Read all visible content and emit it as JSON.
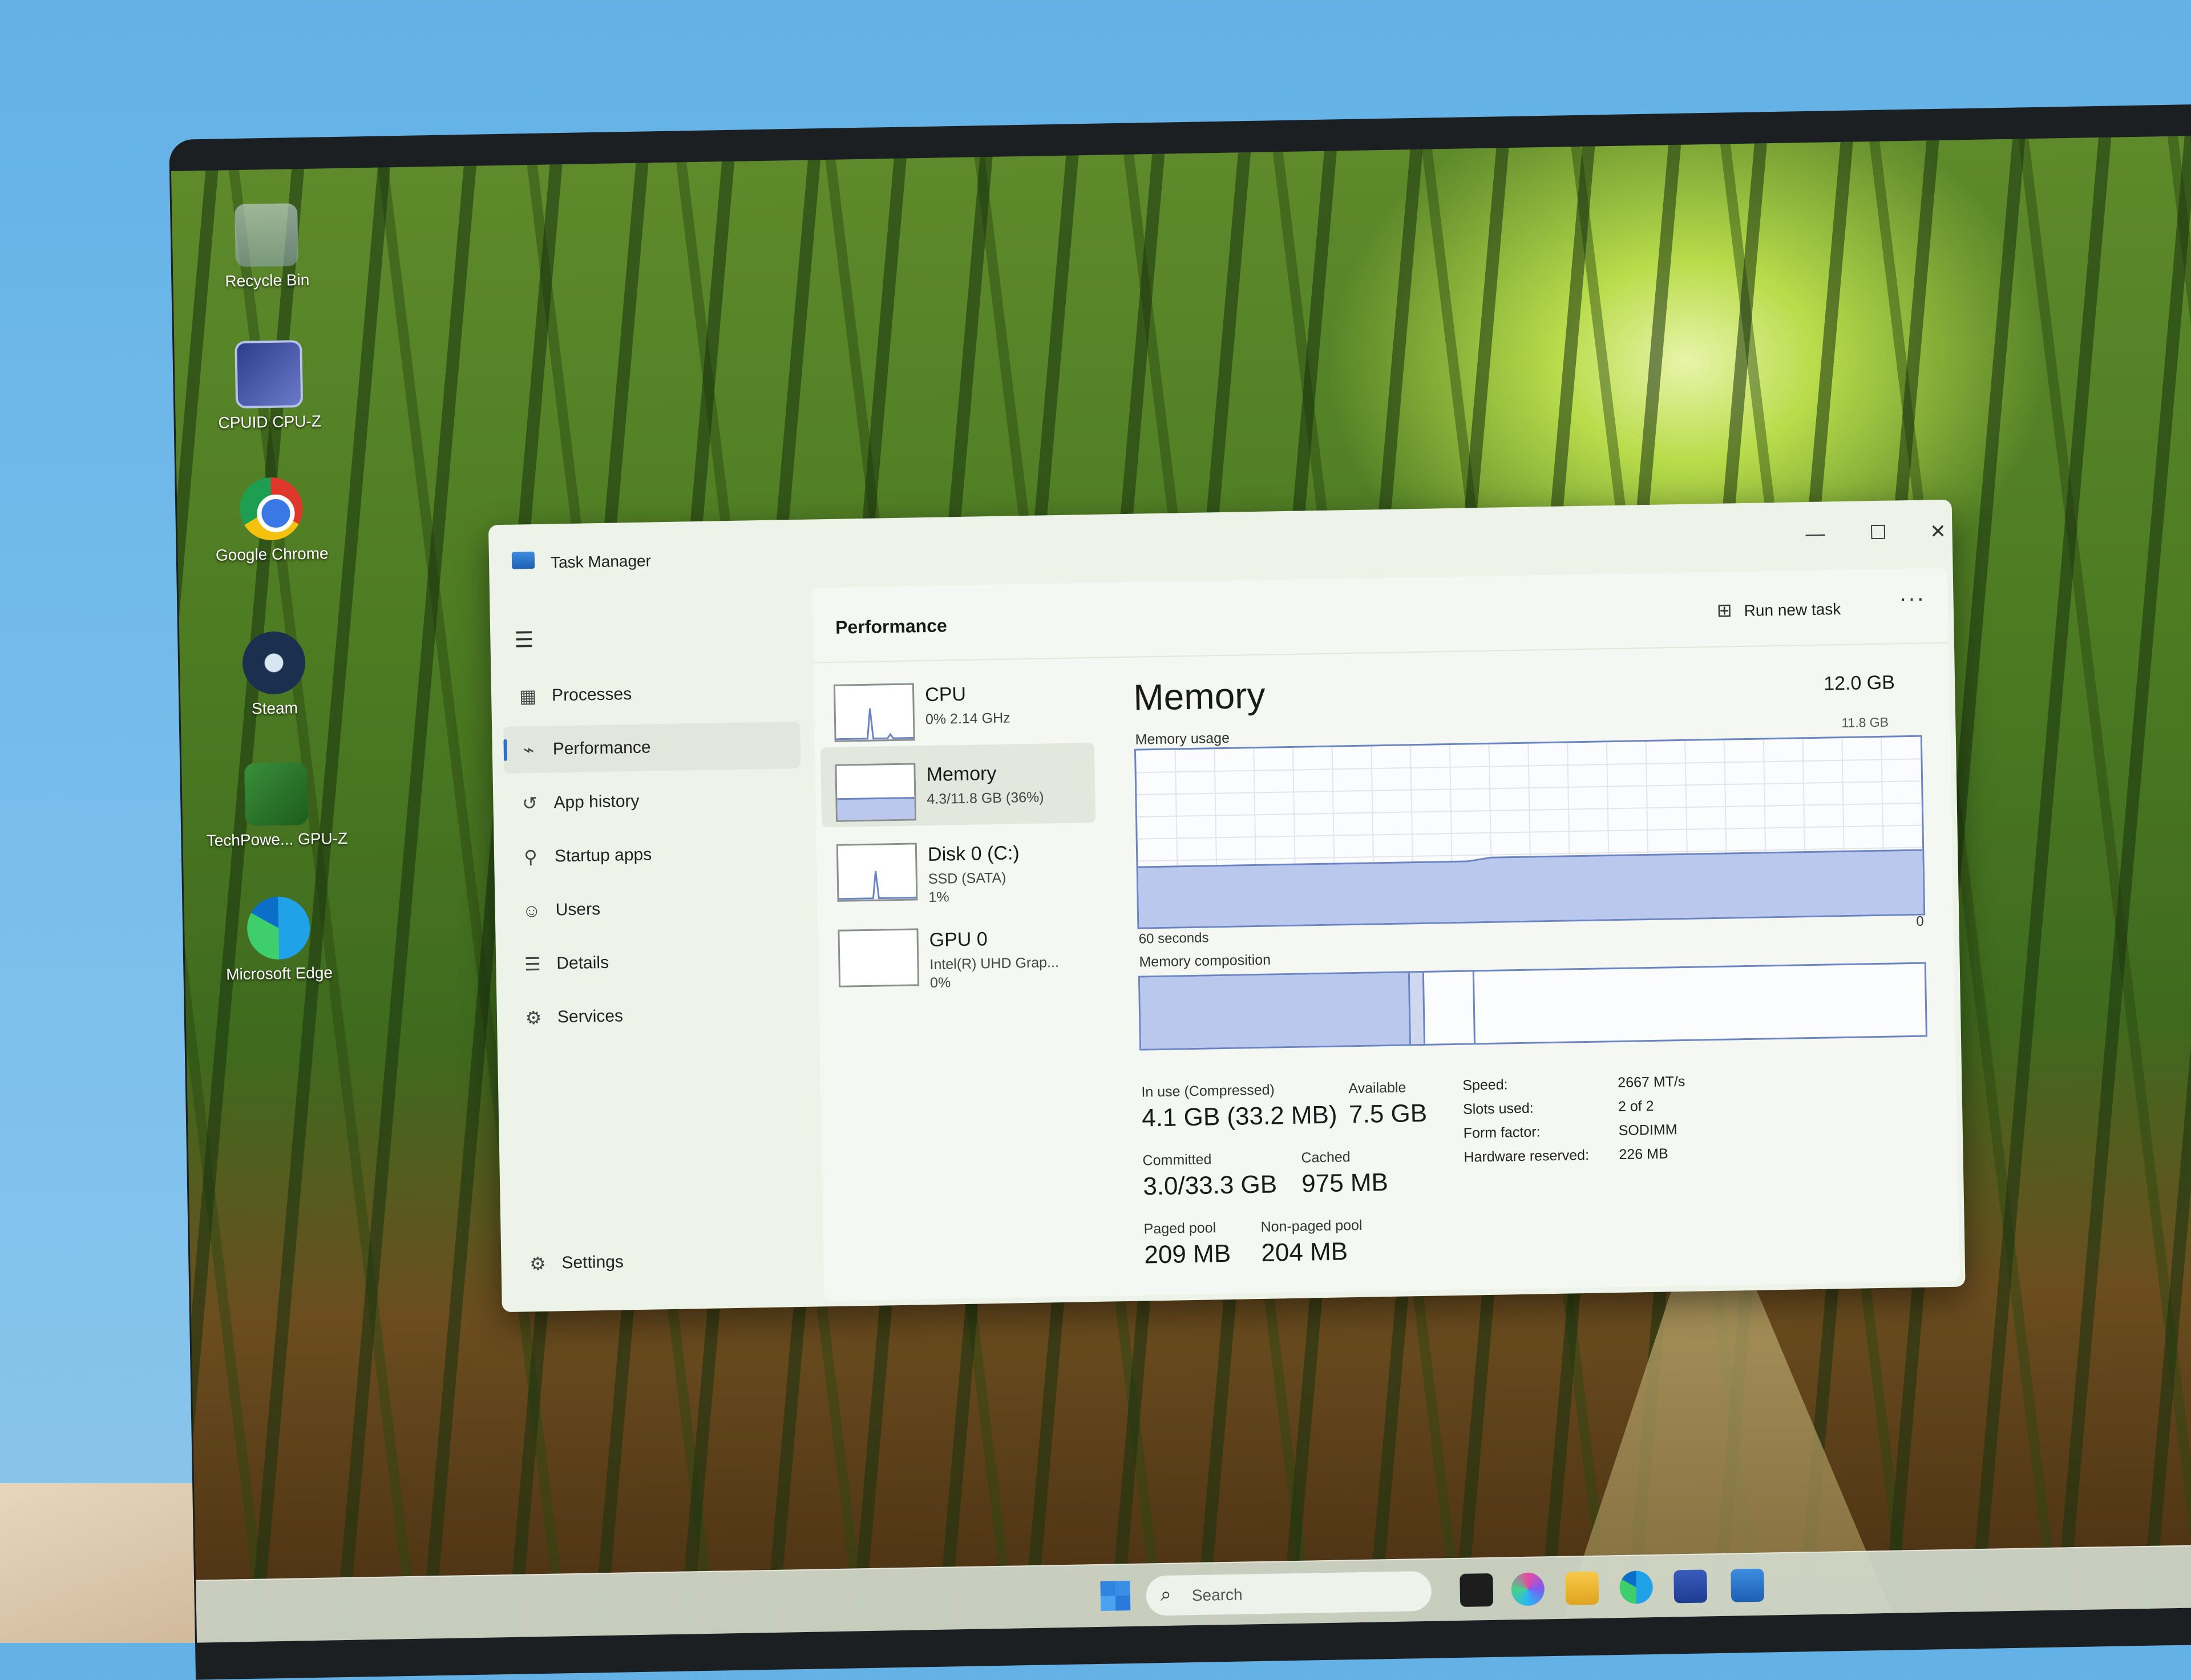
{
  "desktop": {
    "icons": [
      {
        "label": "Recycle Bin",
        "icon": "recycle-bin-icon"
      },
      {
        "label": "CPUID CPU-Z",
        "icon": "cpuz-icon"
      },
      {
        "label": "Google Chrome",
        "icon": "chrome-icon"
      },
      {
        "label": "Steam",
        "icon": "steam-icon"
      },
      {
        "label": "TechPowe... GPU-Z",
        "icon": "gpuz-icon"
      },
      {
        "label": "Microsoft Edge",
        "icon": "edge-icon"
      }
    ]
  },
  "window": {
    "title": "Task Manager",
    "controls": {
      "minimize": "—",
      "maximize": "☐",
      "close": "✕"
    }
  },
  "nav": {
    "items": [
      {
        "label": "Processes",
        "icon": "processes-icon",
        "glyph": "▦"
      },
      {
        "label": "Performance",
        "icon": "performance-icon",
        "glyph": "⌁",
        "active": true
      },
      {
        "label": "App history",
        "icon": "history-icon",
        "glyph": "↺"
      },
      {
        "label": "Startup apps",
        "icon": "startup-icon",
        "glyph": "⚲"
      },
      {
        "label": "Users",
        "icon": "users-icon",
        "glyph": "☺"
      },
      {
        "label": "Details",
        "icon": "details-icon",
        "glyph": "☰"
      },
      {
        "label": "Services",
        "icon": "services-icon",
        "glyph": "⚙"
      }
    ],
    "settings": {
      "label": "Settings",
      "icon": "gear-icon",
      "glyph": "⚙"
    }
  },
  "header": {
    "title": "Performance",
    "run_new_task": "Run new task",
    "more": "···"
  },
  "devices": [
    {
      "name": "CPU",
      "sub1": "0% 2.14 GHz",
      "sub2": ""
    },
    {
      "name": "Memory",
      "sub1": "4.3/11.8 GB (36%)",
      "sub2": "",
      "active": true
    },
    {
      "name": "Disk 0 (C:)",
      "sub1": "SSD (SATA)",
      "sub2": "1%"
    },
    {
      "name": "GPU 0",
      "sub1": "Intel(R) UHD Grap...",
      "sub2": "0%"
    }
  ],
  "memory": {
    "title": "Memory",
    "total": "12.0 GB",
    "usage_label": "Memory usage",
    "usage_max": "11.8 GB",
    "axis_left": "60 seconds",
    "axis_right": "0",
    "composition_label": "Memory composition",
    "usage_fraction": 0.36,
    "stats": {
      "in_use_label": "In use (Compressed)",
      "in_use_value": "4.1 GB (33.2 MB)",
      "available_label": "Available",
      "available_value": "7.5 GB",
      "committed_label": "Committed",
      "committed_value": "3.0/33.3 GB",
      "cached_label": "Cached",
      "cached_value": "975 MB",
      "paged_label": "Paged pool",
      "paged_value": "209 MB",
      "nonpaged_label": "Non-paged pool",
      "nonpaged_value": "204 MB"
    },
    "specs": [
      {
        "label": "Speed:",
        "value": "2667 MT/s"
      },
      {
        "label": "Slots used:",
        "value": "2 of 2"
      },
      {
        "label": "Form factor:",
        "value": "SODIMM"
      },
      {
        "label": "Hardware reserved:",
        "value": "226 MB"
      }
    ]
  },
  "taskbar": {
    "search_placeholder": "Search",
    "apps": [
      "start-icon",
      "task-view-icon",
      "copilot-icon",
      "file-explorer-icon",
      "edge-icon",
      "store-icon",
      "task-manager-icon"
    ]
  },
  "colors": {
    "accent": "#2f6fd1",
    "chart_line": "#6b84c2",
    "chart_fill": "#b9c8ec"
  }
}
